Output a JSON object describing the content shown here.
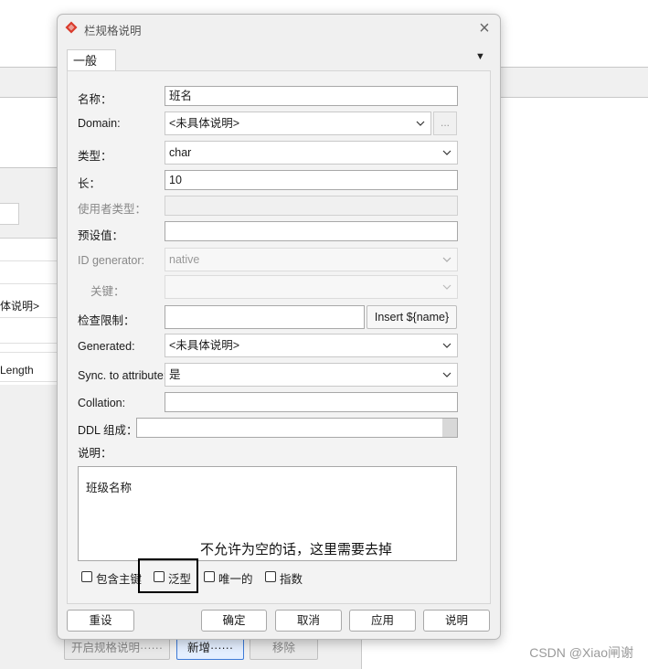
{
  "background": {
    "tab_label": "",
    "rows": [
      "",
      "",
      "体说明>",
      "",
      "",
      "Length"
    ],
    "buttons": [
      {
        "label": "开启规格说明······",
        "active": false
      },
      {
        "label": "新增······",
        "active": true
      },
      {
        "label": "移除",
        "active": false
      }
    ]
  },
  "dialog": {
    "title": "栏规格说明",
    "close_label": "×",
    "tab": "一般",
    "tab_menu_arrow": "▼",
    "fields": {
      "name": {
        "label": "名称：",
        "value": "班名"
      },
      "domain": {
        "label": "Domain:",
        "value": "<未具体说明>",
        "ellipsis": "..."
      },
      "type": {
        "label": "类型：",
        "value": "char"
      },
      "length": {
        "label": "长：",
        "value": "10"
      },
      "user_type": {
        "label": "使用者类型：",
        "value": ""
      },
      "default_value": {
        "label": "预设值：",
        "value": ""
      },
      "id_generator": {
        "label": "ID generator:",
        "value": "native"
      },
      "key": {
        "label": "关键：",
        "value": ""
      },
      "check": {
        "label": "检查限制：",
        "value": "",
        "insert_button": "Insert ${name}"
      },
      "generated": {
        "label": "Generated:",
        "value": "<未具体说明>"
      },
      "sync": {
        "label": "Sync. to attribute:",
        "value": "是"
      },
      "collation": {
        "label": "Collation:",
        "value": ""
      },
      "ddl": {
        "label": "DDL 组成：",
        "value": ""
      },
      "description": {
        "label": "说明：",
        "value": "班级名称"
      }
    },
    "annotation": "不允许为空的话，这里需要去掉",
    "checkboxes": [
      {
        "label": "包含主键",
        "checked": false
      },
      {
        "label": "泛型",
        "checked": false
      },
      {
        "label": "唯一的",
        "checked": false
      },
      {
        "label": "指数",
        "checked": false
      }
    ],
    "buttons": {
      "reset": "重设",
      "ok": "确定",
      "cancel": "取消",
      "apply": "应用",
      "help": "说明"
    }
  },
  "watermark": "CSDN @Xiao闸谢",
  "colors": {
    "accent": "#3d7bd8",
    "icon_red": "#d93a2b",
    "dialog_bg": "#f0f0f0",
    "disabled_text": "#888888"
  }
}
